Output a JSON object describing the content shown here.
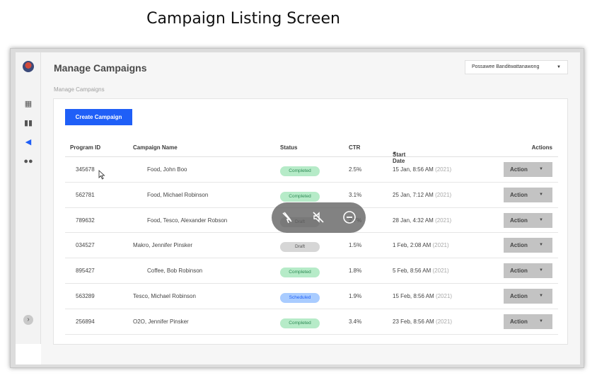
{
  "caption": "Campaign Listing Screen",
  "header": {
    "title": "Manage Campaigns",
    "breadcrumb": "Manage Campaigns",
    "user": "Possawee Banditwattanawong"
  },
  "sidebar": {
    "icons": [
      "logo-icon",
      "dashboard-icon",
      "bar-chart-icon",
      "megaphone-icon",
      "people-icon"
    ],
    "expand_icon": "chevron-right-icon"
  },
  "toolbar": {
    "create_label": "Create Campaign"
  },
  "table": {
    "columns": {
      "program_id": "Program ID",
      "campaign_name": "Campaign Name",
      "status": "Status",
      "ctr": "CTR",
      "start_date": "Start Date",
      "actions": "Actions"
    },
    "rows": [
      {
        "id": "345678",
        "name": "Food, John Boo",
        "status": "Completed",
        "ctr": "2.5%",
        "date": "15 Jan, 8:56 AM",
        "year": "(2021)",
        "action": "Action"
      },
      {
        "id": "562781",
        "name": "Food, Michael Robinson",
        "status": "Completed",
        "ctr": "3.1%",
        "date": "25 Jan, 7:12 AM",
        "year": "(2021)",
        "action": "Action"
      },
      {
        "id": "789632",
        "name": "Food, Tesco, Alexander Robson",
        "status": "Draft",
        "ctr": "2.7%",
        "date": "28 Jan, 4:32 AM",
        "year": "(2021)",
        "action": "Action"
      },
      {
        "id": "034527",
        "name": "Makro, Jennifer Pinsker",
        "status": "Draft",
        "ctr": "1.5%",
        "date": "1 Feb, 2:08 AM",
        "year": "(2021)",
        "action": "Action"
      },
      {
        "id": "895427",
        "name": "Coffee, Bob Robinson",
        "status": "Completed",
        "ctr": "1.8%",
        "date": "5 Feb, 8:56 AM",
        "year": "(2021)",
        "action": "Action"
      },
      {
        "id": "563289",
        "name": "Tesco, Michael Robinson",
        "status": "Scheduled",
        "ctr": "1.9%",
        "date": "15 Feb, 8:56 AM",
        "year": "(2021)",
        "action": "Action"
      },
      {
        "id": "256894",
        "name": "O2O, Jennifer Pinsker",
        "status": "Completed",
        "ctr": "3.4%",
        "date": "23 Feb, 8:56 AM",
        "year": "(2021)",
        "action": "Action"
      }
    ]
  },
  "overlay": {
    "icons": [
      "cursor-off-icon",
      "mute-icon",
      "minus-circle-icon"
    ]
  },
  "colors": {
    "primary": "#1f5ff7",
    "completed": "#b6ebc8",
    "draft": "#d6d6d6",
    "scheduled": "#a9ccff"
  }
}
